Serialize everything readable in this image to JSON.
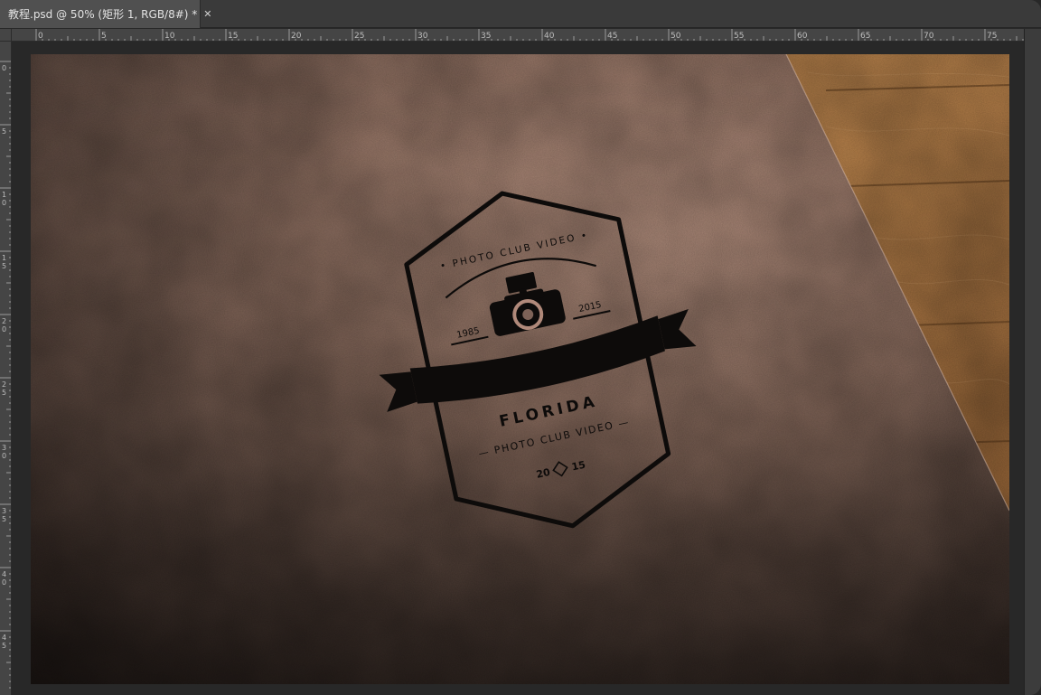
{
  "document_tab": {
    "title": "教程.psd @ 50% (矩形 1, RGB/8#) *",
    "close_glyph": "✕"
  },
  "ruler": {
    "top_labels": [
      "0",
      "5",
      "10",
      "15",
      "20",
      "25",
      "30",
      "35",
      "40",
      "45",
      "50",
      "55",
      "60",
      "65",
      "70",
      "75"
    ],
    "left_labels": [
      "0",
      "5",
      "10",
      "15",
      "20",
      "25",
      "30",
      "35",
      "40",
      "45"
    ]
  },
  "badge": {
    "arc_text": "• PHOTO CLUB VIDEO •",
    "year_left": "1985",
    "year_right": "2015",
    "title": "FLORIDA",
    "subtitle": "— PHOTO CLUB VIDEO —",
    "year_bottom_left": "20",
    "year_bottom_right": "15"
  },
  "colors": {
    "leather_light": "#c29a88",
    "leather_dark": "#2a201c",
    "wood": "#b47c45",
    "ink": "#0d0b0a"
  },
  "icons": {
    "camera": "camera-icon",
    "diamond": "diamond-icon",
    "close": "close-icon"
  }
}
